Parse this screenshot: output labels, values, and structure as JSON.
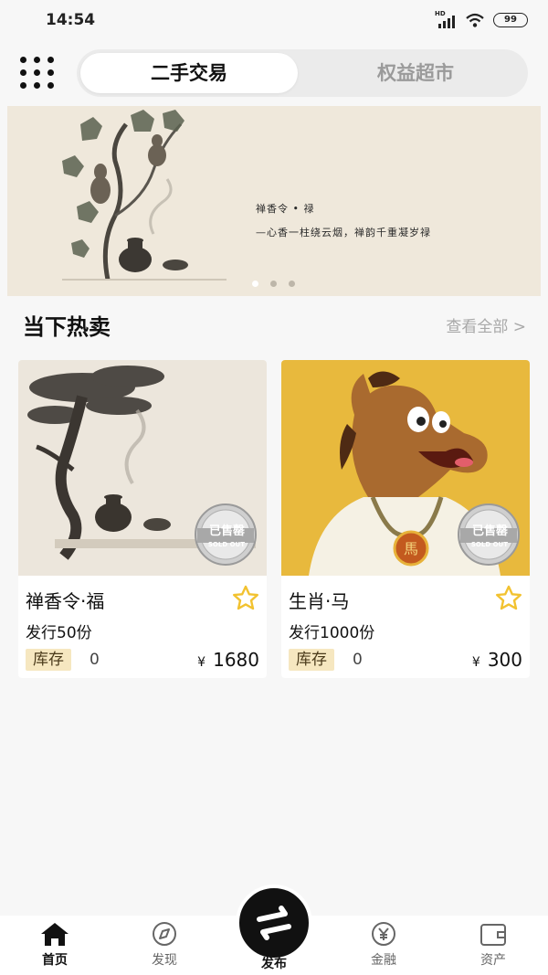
{
  "status_bar": {
    "time": "14:54",
    "network": "HD",
    "battery": "99"
  },
  "header": {
    "tabs": [
      {
        "label": "二手交易",
        "active": true
      },
      {
        "label": "权益超市",
        "active": false
      }
    ]
  },
  "banner": {
    "title": "禅香令 • 禄",
    "subtitle": "—心香一柱绕云烟，禅韵千重凝岁禄",
    "page_indicator": {
      "count": 3,
      "active_index": 0
    }
  },
  "section": {
    "title": "当下热卖",
    "view_all": "查看全部 >"
  },
  "products": [
    {
      "name": "禅香令·福",
      "issue": "发行50份",
      "stock_label": "库存",
      "stock": "0",
      "currency": "¥",
      "price": "1680",
      "badge": {
        "text": "已售罄",
        "sub": "SOLD OUT"
      }
    },
    {
      "name": "生肖·马",
      "issue": "发行1000份",
      "stock_label": "库存",
      "stock": "0",
      "currency": "¥",
      "price": "300",
      "badge": {
        "text": "已售罄",
        "sub": "SOLD OUT"
      },
      "medal_char": "馬"
    }
  ],
  "bottom_nav": [
    {
      "label": "首页",
      "icon": "home-icon",
      "active": true
    },
    {
      "label": "发现",
      "icon": "compass-icon",
      "active": false
    },
    {
      "label": "发布",
      "icon": "swap-arrows-icon",
      "active": false
    },
    {
      "label": "金融",
      "icon": "yen-circle-icon",
      "active": false
    },
    {
      "label": "资产",
      "icon": "wallet-icon",
      "active": false
    }
  ],
  "colors": {
    "background": "#f7f7f7",
    "stock_tag": "#f6e7c0",
    "star": "#f2c230",
    "horse_bg": "#e8b93d",
    "banner_bg": "#efe8db"
  }
}
